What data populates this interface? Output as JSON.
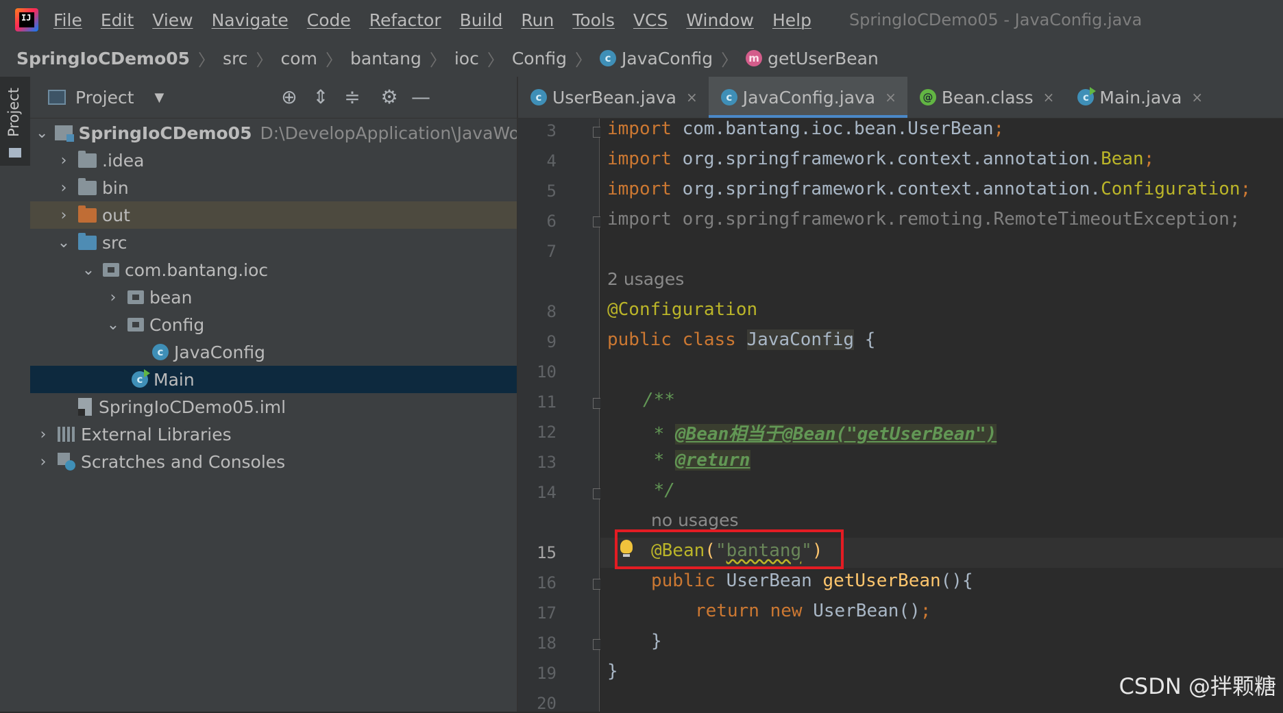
{
  "menubar": {
    "items": [
      "File",
      "Edit",
      "View",
      "Navigate",
      "Code",
      "Refactor",
      "Build",
      "Run",
      "Tools",
      "VCS",
      "Window",
      "Help"
    ],
    "window_title": "SpringIoCDemo05 - JavaConfig.java"
  },
  "breadcrumb": [
    "SpringIoCDemo05",
    "src",
    "com",
    "bantang",
    "ioc",
    "Config",
    "JavaConfig",
    "getUserBean"
  ],
  "tool_window": {
    "label": "Project"
  },
  "project_panel": {
    "title": "Project",
    "tree": [
      {
        "label": "SpringIoCDemo05",
        "detail": "D:\\DevelopApplication\\JavaWorkS"
      },
      {
        "label": ".idea"
      },
      {
        "label": "bin"
      },
      {
        "label": "out"
      },
      {
        "label": "src"
      },
      {
        "label": "com.bantang.ioc"
      },
      {
        "label": "bean"
      },
      {
        "label": "Config"
      },
      {
        "label": "JavaConfig"
      },
      {
        "label": "Main"
      },
      {
        "label": "SpringIoCDemo05.iml"
      },
      {
        "label": "External Libraries"
      },
      {
        "label": "Scratches and Consoles"
      }
    ]
  },
  "tabs": [
    {
      "label": "UserBean.java",
      "close": "×"
    },
    {
      "label": "JavaConfig.java",
      "close": "×"
    },
    {
      "label": "Bean.class",
      "close": "×"
    },
    {
      "label": "Main.java",
      "close": "×"
    }
  ],
  "editor": {
    "line_numbers": [
      "3",
      "4",
      "5",
      "6",
      "7",
      "8",
      "9",
      "10",
      "11",
      "12",
      "13",
      "14",
      "15",
      "16",
      "17",
      "18",
      "19",
      "20"
    ],
    "usages_2": "2 usages",
    "no_usages": "no usages",
    "code": {
      "l3_kw": "import",
      "l3_rest": " com.bantang.ioc.bean.UserBean",
      "l4_kw": "import",
      "l4_rest": " org.springframework.context.annotation.",
      "l4_cls": "Bean",
      "l5_kw": "import",
      "l5_rest": " org.springframework.context.annotation.",
      "l5_cls": "Configuration",
      "l6": "import org.springframework.remoting.RemoteTimeoutException;",
      "l8": "@Configuration",
      "l9_kw": "public class ",
      "l9_cls": "JavaConfig",
      "l9_rest": " {",
      "l11": "/**",
      "l12_star": " * ",
      "l12_tag": "@Bean相当于@Bean(\"getUserBean\")",
      "l13_star": " * ",
      "l13_tag": "@return",
      "l14": " */",
      "l15_ann": "@Bean",
      "l15_open": "(",
      "l15_q1": "\"",
      "l15_str": "bantang",
      "l15_q2": "\"",
      "l15_close": ")",
      "l16_kw": "public ",
      "l16_type": "UserBean ",
      "l16_fn": "getUserBean",
      "l16_rest": "(){",
      "l17_kw": "return new ",
      "l17_rest": "UserBean()",
      "l18": "}",
      "l19": "}",
      "semi": ";"
    }
  },
  "watermark": "CSDN @拌颗糖",
  "colors": {
    "accent": "#4a88c7",
    "highlight_box": "#e31c23"
  }
}
